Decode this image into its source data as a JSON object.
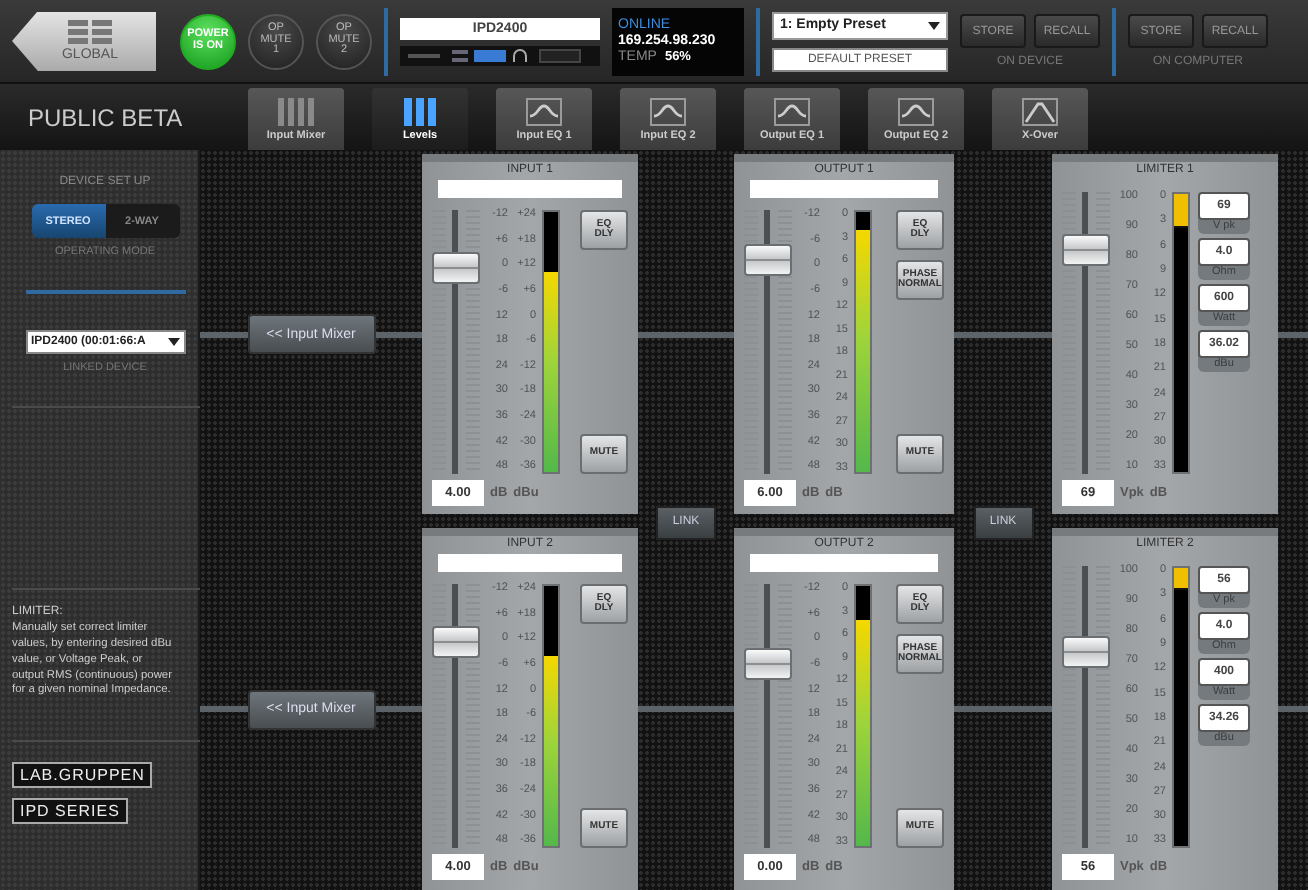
{
  "header": {
    "global_button": "GLOBAL",
    "power": {
      "label": "POWER\nIS ON",
      "on": true
    },
    "op_mutes": [
      {
        "label": "OP\nMUTE\n1",
        "on": false
      },
      {
        "label": "OP\nMUTE\n2",
        "on": false
      }
    ],
    "device": {
      "name": "IPD2400"
    },
    "status": {
      "state": "ONLINE",
      "ip": "169.254.98.230",
      "temp_label": "TEMP",
      "temp": "56%"
    },
    "preset": {
      "selected": "1: Empty Preset",
      "default": "DEFAULT PRESET"
    },
    "store_groups": [
      {
        "buttons": [
          "STORE",
          "RECALL"
        ],
        "caption": "ON DEVICE"
      },
      {
        "buttons": [
          "STORE",
          "RECALL"
        ],
        "caption": "ON COMPUTER"
      }
    ]
  },
  "app_title": "PUBLIC BETA",
  "tabs": [
    {
      "label": "Input Mixer",
      "selected": false
    },
    {
      "label": "Levels",
      "selected": true
    },
    {
      "label": "Input EQ 1",
      "selected": false
    },
    {
      "label": "Input EQ 2",
      "selected": false
    },
    {
      "label": "Output EQ 1",
      "selected": false
    },
    {
      "label": "Output EQ 2",
      "selected": false
    },
    {
      "label": "X-Over",
      "selected": false
    }
  ],
  "sidebar": {
    "heading": "DEVICE SET UP",
    "modes": [
      {
        "label": "STEREO",
        "selected": true
      },
      {
        "label": "2-WAY",
        "selected": false
      }
    ],
    "mode_caption": "OPERATING MODE",
    "linked_device": "IPD2400 (00:01:66:A",
    "linked_caption": "LINKED DEVICE",
    "help_title": "LIMITER:",
    "help_text": "Manually set correct limiter values, by entering desired dBu value, or Voltage Peak, or output RMS (continuous) power for a given nominal Impedance.",
    "logos": [
      "LAB.GRUPPEN",
      "IPD SERIES"
    ]
  },
  "links": [
    "LINK",
    "LINK"
  ],
  "rows": [
    {
      "mixer_button": "<< Input Mixer",
      "input": {
        "title": "INPUT 1",
        "fader_scale": [
          "-12",
          "+6",
          "0",
          "-6",
          "12",
          "18",
          "24",
          "30",
          "36",
          "42",
          "48"
        ],
        "meter_scale": [
          "+24",
          "+18",
          "+12",
          "+6",
          "0",
          "-6",
          "-12",
          "-18",
          "-24",
          "-30",
          "-36"
        ],
        "fader": {
          "level": 0.82
        },
        "meter": {
          "level": 0.77
        },
        "buttons": [
          "EQ\nDLY"
        ],
        "mute": "MUTE",
        "value": "4.00",
        "units": [
          "dB",
          "dBu"
        ]
      },
      "output": {
        "title": "OUTPUT 1",
        "fader_scale": [
          "-12",
          "-6",
          "0",
          "-6",
          "12",
          "18",
          "24",
          "30",
          "36",
          "42",
          "48"
        ],
        "meter_scale": [
          "0",
          "3",
          "6",
          "9",
          "12",
          "15",
          "18",
          "21",
          "24",
          "27",
          "30",
          "33"
        ],
        "fader": {
          "level": 0.85
        },
        "meter": {
          "level": 0.93
        },
        "buttons": [
          "EQ\nDLY",
          "PHASE\nNORMAL"
        ],
        "mute": "MUTE",
        "value": "6.00",
        "units": [
          "dB",
          "dB"
        ]
      },
      "limiter": {
        "title": "LIMITER 1",
        "fader_scale": [
          "100",
          "90",
          "80",
          "70",
          "60",
          "50",
          "40",
          "30",
          "20",
          "10"
        ],
        "meter_scale": [
          "0",
          "3",
          "6",
          "9",
          "12",
          "15",
          "18",
          "21",
          "24",
          "27",
          "30",
          "33"
        ],
        "fader": {
          "level": 0.83
        },
        "meter": {
          "level": 0.12
        },
        "fields": [
          {
            "value": "69",
            "unit": "V pk"
          },
          {
            "value": "4.0",
            "unit": "Ohm"
          },
          {
            "value": "600",
            "unit": "Watt"
          },
          {
            "value": "36.02",
            "unit": "dBu"
          }
        ],
        "value": "69",
        "units": [
          "Vpk",
          "dB"
        ]
      }
    },
    {
      "mixer_button": "<< Input Mixer",
      "input": {
        "title": "INPUT 2",
        "fader_scale": [
          "-12",
          "+6",
          "0",
          "-6",
          "12",
          "18",
          "24",
          "30",
          "36",
          "42",
          "48"
        ],
        "meter_scale": [
          "+24",
          "+18",
          "+12",
          "+6",
          "0",
          "-6",
          "-12",
          "-18",
          "-24",
          "-30",
          "-36"
        ],
        "fader": {
          "level": 0.82
        },
        "meter": {
          "level": 0.73
        },
        "buttons": [
          "EQ\nDLY"
        ],
        "mute": "MUTE",
        "value": "4.00",
        "units": [
          "dB",
          "dBu"
        ]
      },
      "output": {
        "title": "OUTPUT 2",
        "fader_scale": [
          "-12",
          "+6",
          "0",
          "-6",
          "12",
          "18",
          "24",
          "30",
          "36",
          "42",
          "48"
        ],
        "meter_scale": [
          "0",
          "3",
          "6",
          "9",
          "12",
          "15",
          "18",
          "21",
          "24",
          "27",
          "30",
          "33"
        ],
        "fader": {
          "level": 0.72
        },
        "meter": {
          "level": 0.87
        },
        "buttons": [
          "EQ\nDLY",
          "PHASE\nNORMAL"
        ],
        "mute": "MUTE",
        "value": "0.00",
        "units": [
          "dB",
          "dB"
        ]
      },
      "limiter": {
        "title": "LIMITER 2",
        "fader_scale": [
          "100",
          "90",
          "80",
          "70",
          "60",
          "50",
          "40",
          "30",
          "20",
          "10"
        ],
        "meter_scale": [
          "0",
          "3",
          "6",
          "9",
          "12",
          "15",
          "18",
          "21",
          "24",
          "27",
          "30",
          "33"
        ],
        "fader": {
          "level": 0.72
        },
        "meter": {
          "level": 0.08
        },
        "fields": [
          {
            "value": "56",
            "unit": "V pk"
          },
          {
            "value": "4.0",
            "unit": "Ohm"
          },
          {
            "value": "400",
            "unit": "Watt"
          },
          {
            "value": "34.26",
            "unit": "dBu"
          }
        ],
        "value": "56",
        "units": [
          "Vpk",
          "dB"
        ]
      }
    }
  ]
}
